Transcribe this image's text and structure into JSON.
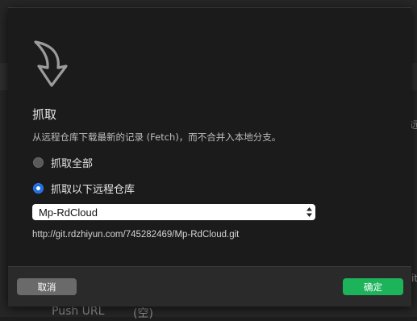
{
  "background": {
    "right_fragment_1": "远",
    "right_fragment_2": "it",
    "push_url_label": "Push URL",
    "push_url_value": "(空)"
  },
  "dialog": {
    "icon": "fetch-arrow-icon",
    "title": "抓取",
    "description": "从远程仓库下载最新的记录 (Fetch)，而不合并入本地分支。",
    "options": [
      {
        "label": "抓取全部",
        "selected": false
      },
      {
        "label": "抓取以下远程仓库",
        "selected": true
      }
    ],
    "remote_select": {
      "value": "Mp-RdCloud"
    },
    "remote_url": "http://git.rdzhiyun.com/745282469/Mp-RdCloud.git",
    "cancel_label": "取消",
    "ok_label": "确定"
  },
  "colors": {
    "accent": "#1d6fe0",
    "ok_button": "#1db35a",
    "cancel_button": "#6a6a6a"
  }
}
